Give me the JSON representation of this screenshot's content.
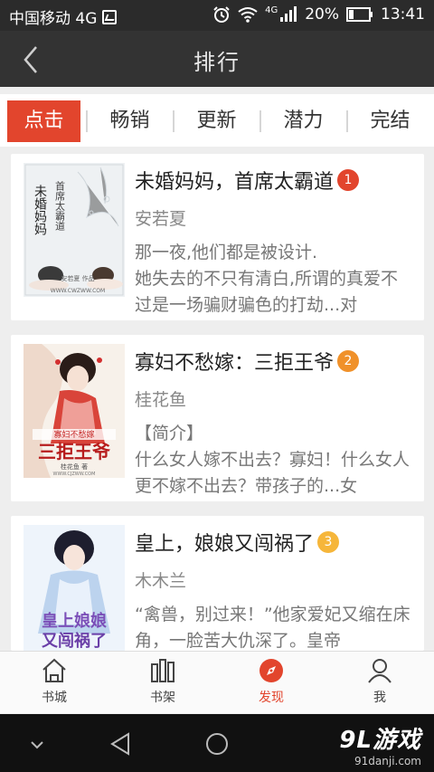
{
  "status_bar": {
    "carrier": "中国移动 4G",
    "network": "4G",
    "battery": "20%",
    "time": "13:41"
  },
  "header": {
    "title": "排行"
  },
  "tabs": [
    {
      "label": "点击",
      "active": true
    },
    {
      "label": "畅销",
      "active": false
    },
    {
      "label": "更新",
      "active": false
    },
    {
      "label": "潜力",
      "active": false
    },
    {
      "label": "完结",
      "active": false
    }
  ],
  "books": [
    {
      "title": "未婚妈妈，首席太霸道",
      "rank": "1",
      "rank_color": "#e2452d",
      "author": "安若夏",
      "desc": "那一夜,他们都是被设计.\n她失去的不只有清白,所谓的真爱不过是一场骗财骗色的打劫...对",
      "cover_text": [
        "未婚妈妈",
        "首席太霸道"
      ],
      "cover_author": "安若夏 作品",
      "cover_site": "WWW.CWZWW.COM"
    },
    {
      "title": "寡妇不愁嫁：三拒王爷",
      "rank": "2",
      "rank_color": "#f0912a",
      "author": "桂花鱼",
      "desc": "【简介】\n什么女人嫁不出去？寡妇！什么女人更不嫁不出去？带孩子的...女",
      "cover_text": [
        "寡妇不愁嫁",
        "三拒王爷"
      ],
      "cover_author": "桂花鱼 著",
      "cover_site": "WWW.CJZWW.COM"
    },
    {
      "title": "皇上，娘娘又闯祸了",
      "rank": "3",
      "rank_color": "#f6b63a",
      "author": "木木兰",
      "desc": "“禽兽，别过来！”他家爱妃又缩在床角，一脸苦大仇深了。皇帝",
      "cover_text": [
        "皇上娘娘",
        "又闯祸了"
      ]
    }
  ],
  "bottom_nav": [
    {
      "label": "书城",
      "icon": "home-icon",
      "active": false
    },
    {
      "label": "书架",
      "icon": "bookshelf-icon",
      "active": false
    },
    {
      "label": "发现",
      "icon": "compass-icon",
      "active": true
    },
    {
      "label": "我",
      "icon": "person-icon",
      "active": false
    }
  ],
  "watermark": {
    "main": "9L游戏",
    "sub": "91danji.com"
  },
  "colors": {
    "accent": "#e2452d",
    "title_bar": "#333333",
    "status_bar": "#2b2b2b"
  }
}
